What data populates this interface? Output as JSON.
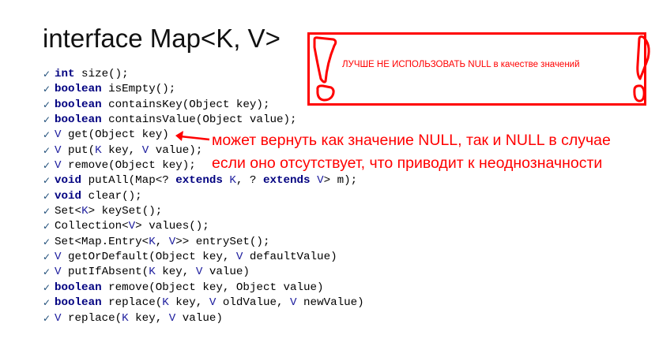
{
  "title": "interface Map<K, V>",
  "warning": {
    "text": "ЛУЧШЕ НЕ ИСПОЛЬЗОВАТЬ NULL в качестве значений",
    "color": "#ff0000"
  },
  "note": {
    "line1": "может вернуть как значение NULL, так и NULL в случае",
    "line2": "если оно отсутствует, что приводит к неоднозначности",
    "color": "#ff0000"
  },
  "bullet_icon": "check-icon",
  "colors": {
    "keyword": "#000080",
    "type_param": "#20209f",
    "accent": "#ff0000"
  },
  "methods": [
    [
      {
        "t": "int",
        "c": "kw"
      },
      {
        "t": " size();",
        "c": "pl"
      }
    ],
    [
      {
        "t": "boolean",
        "c": "kw"
      },
      {
        "t": " isEmpty();",
        "c": "pl"
      }
    ],
    [
      {
        "t": "boolean",
        "c": "kw"
      },
      {
        "t": " containsKey(Object key);",
        "c": "pl"
      }
    ],
    [
      {
        "t": "boolean",
        "c": "kw"
      },
      {
        "t": " containsValue(Object value);",
        "c": "pl"
      }
    ],
    [
      {
        "t": "V",
        "c": "tp"
      },
      {
        "t": " get(Object key)",
        "c": "pl"
      }
    ],
    [
      {
        "t": "V",
        "c": "tp"
      },
      {
        "t": " put(",
        "c": "pl"
      },
      {
        "t": "K",
        "c": "tp"
      },
      {
        "t": " key, ",
        "c": "pl"
      },
      {
        "t": "V",
        "c": "tp"
      },
      {
        "t": " value);",
        "c": "pl"
      }
    ],
    [
      {
        "t": "V",
        "c": "tp"
      },
      {
        "t": " remove(Object key);",
        "c": "pl"
      }
    ],
    [
      {
        "t": "void",
        "c": "kw"
      },
      {
        "t": " putAll(Map<? ",
        "c": "pl"
      },
      {
        "t": "extends",
        "c": "kw"
      },
      {
        "t": " ",
        "c": "pl"
      },
      {
        "t": "K",
        "c": "tp"
      },
      {
        "t": ", ? ",
        "c": "pl"
      },
      {
        "t": "extends",
        "c": "kw"
      },
      {
        "t": " ",
        "c": "pl"
      },
      {
        "t": "V",
        "c": "tp"
      },
      {
        "t": "> m);",
        "c": "pl"
      }
    ],
    [
      {
        "t": "void",
        "c": "kw"
      },
      {
        "t": " clear();",
        "c": "pl"
      }
    ],
    [
      {
        "t": "Set<",
        "c": "pl"
      },
      {
        "t": "K",
        "c": "tp"
      },
      {
        "t": "> keySet();",
        "c": "pl"
      }
    ],
    [
      {
        "t": "Collection<",
        "c": "pl"
      },
      {
        "t": "V",
        "c": "tp"
      },
      {
        "t": "> values();",
        "c": "pl"
      }
    ],
    [
      {
        "t": "Set<Map.Entry<",
        "c": "pl"
      },
      {
        "t": "K",
        "c": "tp"
      },
      {
        "t": ", ",
        "c": "pl"
      },
      {
        "t": "V",
        "c": "tp"
      },
      {
        "t": ">> entrySet();",
        "c": "pl"
      }
    ],
    [
      {
        "t": "V",
        "c": "tp"
      },
      {
        "t": " getOrDefault(Object key, ",
        "c": "pl"
      },
      {
        "t": "V",
        "c": "tp"
      },
      {
        "t": " defaultValue)",
        "c": "pl"
      }
    ],
    [
      {
        "t": "V",
        "c": "tp"
      },
      {
        "t": " putIfAbsent(",
        "c": "pl"
      },
      {
        "t": "K",
        "c": "tp"
      },
      {
        "t": " key, ",
        "c": "pl"
      },
      {
        "t": "V",
        "c": "tp"
      },
      {
        "t": " value)",
        "c": "pl"
      }
    ],
    [
      {
        "t": "boolean",
        "c": "kw"
      },
      {
        "t": " remove(Object key, Object value)",
        "c": "pl"
      }
    ],
    [
      {
        "t": "boolean",
        "c": "kw"
      },
      {
        "t": " replace(",
        "c": "pl"
      },
      {
        "t": "K",
        "c": "tp"
      },
      {
        "t": " key, ",
        "c": "pl"
      },
      {
        "t": "V",
        "c": "tp"
      },
      {
        "t": " oldValue, ",
        "c": "pl"
      },
      {
        "t": "V",
        "c": "tp"
      },
      {
        "t": " newValue)",
        "c": "pl"
      }
    ],
    [
      {
        "t": "V",
        "c": "tp"
      },
      {
        "t": " replace(",
        "c": "pl"
      },
      {
        "t": "K",
        "c": "tp"
      },
      {
        "t": " key, ",
        "c": "pl"
      },
      {
        "t": "V",
        "c": "tp"
      },
      {
        "t": " value)",
        "c": "pl"
      }
    ]
  ]
}
